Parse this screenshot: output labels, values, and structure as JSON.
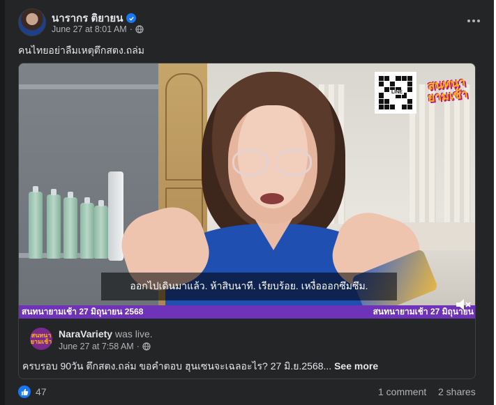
{
  "post": {
    "author": "นารากร ติยายน",
    "timestamp": "June 27 at 8:01 AM",
    "separator": "·",
    "caption": "คนไทยอย่าลืมเหตุตึกสตง.ถล่ม",
    "audience_icon": "globe-icon",
    "verified_icon": "verified-badge-icon"
  },
  "video": {
    "subtitle": "ออกไปเดินมาแล้ว. ห้าสิบนาที. เรียบร้อย. เหงื่อออกซึมซึม.",
    "ticker_left": "สนทนายามเช้า 27 มิถุนายน 2568",
    "ticker_right": "สนทนายามเช้า 27 มิถุนายน",
    "qr_label": "LINE",
    "logo_text": "สนทนา ยามเช้า",
    "muted_icon": "volume-muted-icon"
  },
  "shared": {
    "page_name": "NaraVariety",
    "status": "was live.",
    "timestamp": "June 27 at 7:58 AM",
    "separator": "·",
    "description": "ครบรอบ 90วัน ตึกสตง.ถล่ม ขอคำตอบ  ฮุนเซนจะเฉลอะไร? 27 มิ.ย.2568... ",
    "see_more": "See more",
    "avatar_text": "สนทนา ยามเช้า"
  },
  "footer": {
    "reaction_count": "47",
    "comments": "1 comment",
    "shares": "2 shares",
    "reaction_icon": "like-icon"
  },
  "colors": {
    "card_bg": "#242526",
    "text_primary": "#e4e6eb",
    "text_secondary": "#b0b3b8",
    "accent": "#1877f2",
    "ticker": "#6e33b8"
  }
}
